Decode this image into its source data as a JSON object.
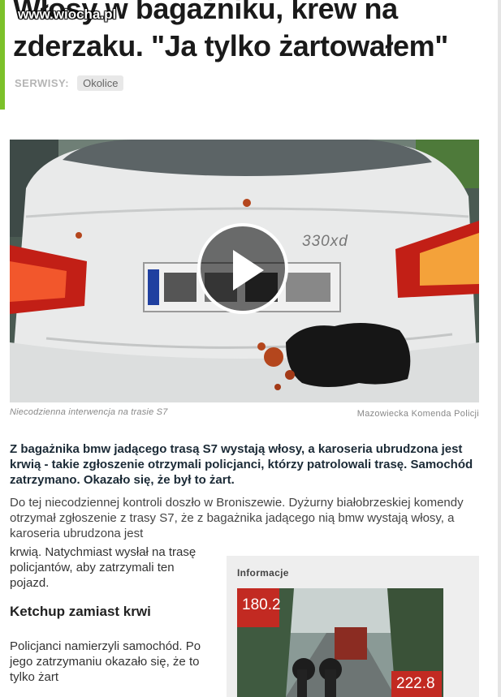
{
  "article": {
    "title": "Włosy w bagażniku, krew na zderzaku. \"Ja tylko żartowałem\"",
    "watermark": "www.wiocha.pl",
    "services_label": "SERWISY:",
    "service_tag": "Okolice",
    "media": {
      "caption": "Niecodzienna interwencja na trasie S7",
      "credit": "Mazowiecka Komenda Policji",
      "badge_text": "330xd",
      "icon": "play-icon"
    },
    "lead": "Z bagażnika bmw jadącego trasą S7 wystają włosy, a karoseria ubrudzona jest krwią - takie zgłoszenie otrzymali policjanci, którzy patrolowali trasę. Samochód zatrzymano. Okazało się, że był to żart.",
    "paragraph1": "Do tej niecodziennej kontroli doszło w Broniszewie. Dyżurny białobrzeskiej komendy otrzymał zgłoszenie z trasy S7, że z bagażnika jadącego nią bmw wystają włosy, a karoseria ubrudzona jest",
    "paragraph2": "krwią. Natychmiast wysłał na trasę policjantów, aby zatrzymali ten pojazd.",
    "subheading": "Ketchup zamiast krwi",
    "paragraph3": "Policjanci namierzyli samochód. Po jego zatrzymaniu okazało się, że to tylko żart"
  },
  "info_box": {
    "title": "Informacje",
    "speed_top": "180.2",
    "speed_bottom": "222.8"
  },
  "colors": {
    "accent": "#7cc12a",
    "car_body": "#e9eaea",
    "taillight": "#d3261c",
    "ketchup": "#b4461d"
  }
}
